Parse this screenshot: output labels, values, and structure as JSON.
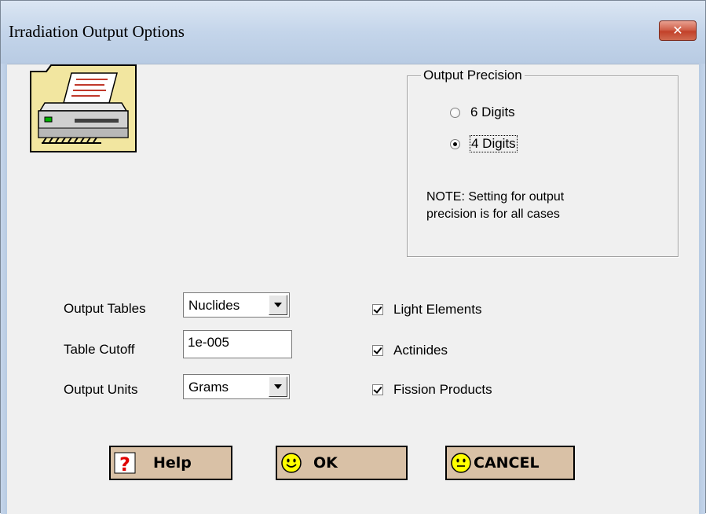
{
  "window": {
    "title": "Irradiation Output Options",
    "close_glyph": "✕"
  },
  "precision": {
    "group_label": "Output Precision",
    "options": [
      {
        "label": "6 Digits",
        "selected": false
      },
      {
        "label": "4 Digits",
        "selected": true
      }
    ],
    "note_line1": "NOTE: Setting for output",
    "note_line2": "precision is for all cases"
  },
  "form": {
    "output_tables_label": "Output Tables",
    "output_tables_value": "Nuclides",
    "table_cutoff_label": "Table Cutoff",
    "table_cutoff_value": "1e-005",
    "output_units_label": "Output Units",
    "output_units_value": "Grams"
  },
  "checkboxes": [
    {
      "label": "Light Elements",
      "checked": true
    },
    {
      "label": "Actinides",
      "checked": true
    },
    {
      "label": "Fission Products",
      "checked": true
    }
  ],
  "buttons": {
    "help_label": "Help",
    "ok_label": "OK",
    "cancel_label": "CANCEL"
  },
  "icons": {
    "header": "printer-icon",
    "help": "question-mark-icon",
    "ok": "smiley-face-icon",
    "cancel": "neutral-face-icon"
  },
  "colors": {
    "button_bg": "#d9c1a6",
    "close_button": "#c2412a",
    "icon_folder": "#f2e6a0",
    "smiley": "#ffff00"
  }
}
